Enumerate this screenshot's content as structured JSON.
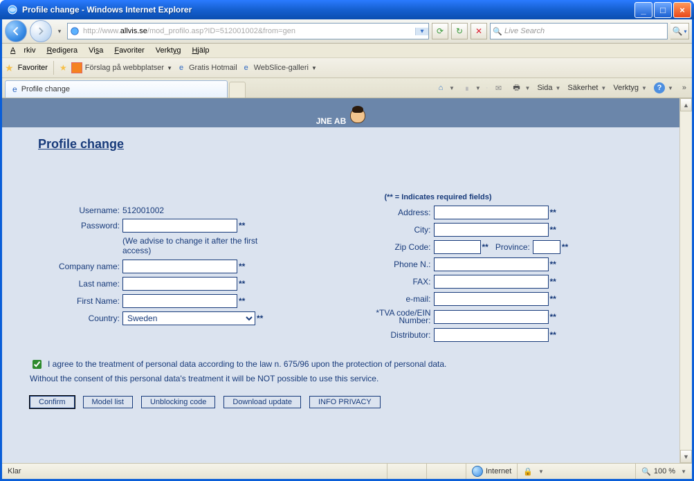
{
  "window": {
    "title": "Profile change - Windows Internet Explorer"
  },
  "address": {
    "prefix": "http://www.",
    "host": "allvis.se",
    "path": "/mod_profilo.asp?ID=512001002&from=gen"
  },
  "menu": {
    "arkiv": "Arkiv",
    "redigera": "Redigera",
    "visa": "Visa",
    "favoriter": "Favoriter",
    "verktyg": "Verktyg",
    "hjalp": "Hjälp"
  },
  "favbar": {
    "favoriter": "Favoriter",
    "forslag": "Förslag på webbplatser",
    "hotmail": "Gratis Hotmail",
    "webslice": "WebSlice-galleri"
  },
  "tab": {
    "title": "Profile change"
  },
  "cmd": {
    "sida": "Sida",
    "sakerhet": "Säkerhet",
    "verktyg": "Verktyg"
  },
  "search": {
    "placeholder": "Live Search"
  },
  "banner": "JNE AB",
  "page": {
    "heading": "Profile change",
    "required_note": "(** = Indicates required fields)",
    "labels": {
      "username": "Username:",
      "password": "Password:",
      "password_hint": "(We advise to change it after the first access)",
      "company": "Company name:",
      "lastname": "Last name:",
      "firstname": "First Name:",
      "country": "Country:",
      "address": "Address:",
      "city": "City:",
      "zip": "Zip Code:",
      "province": "Province:",
      "phone": "Phone N.:",
      "fax": "FAX:",
      "email": "e-mail:",
      "tva": "*TVA code/EIN Number:",
      "distributor": "Distributor:"
    },
    "values": {
      "username": "512001002",
      "country": "Sweden"
    },
    "consent": "I agree to the treatment of personal data according to the law n. 675/96 upon the protection of personal data.",
    "consent_note": "Without the consent of this personal data's treatment it will be NOT possible to use this service.",
    "buttons": {
      "confirm": "Confirm",
      "model": "Model list",
      "unblock": "Unblocking code",
      "download": "Download update",
      "privacy": "INFO PRIVACY"
    }
  },
  "status": {
    "klar": "Klar",
    "internet": "Internet",
    "zoom": "100 %"
  }
}
